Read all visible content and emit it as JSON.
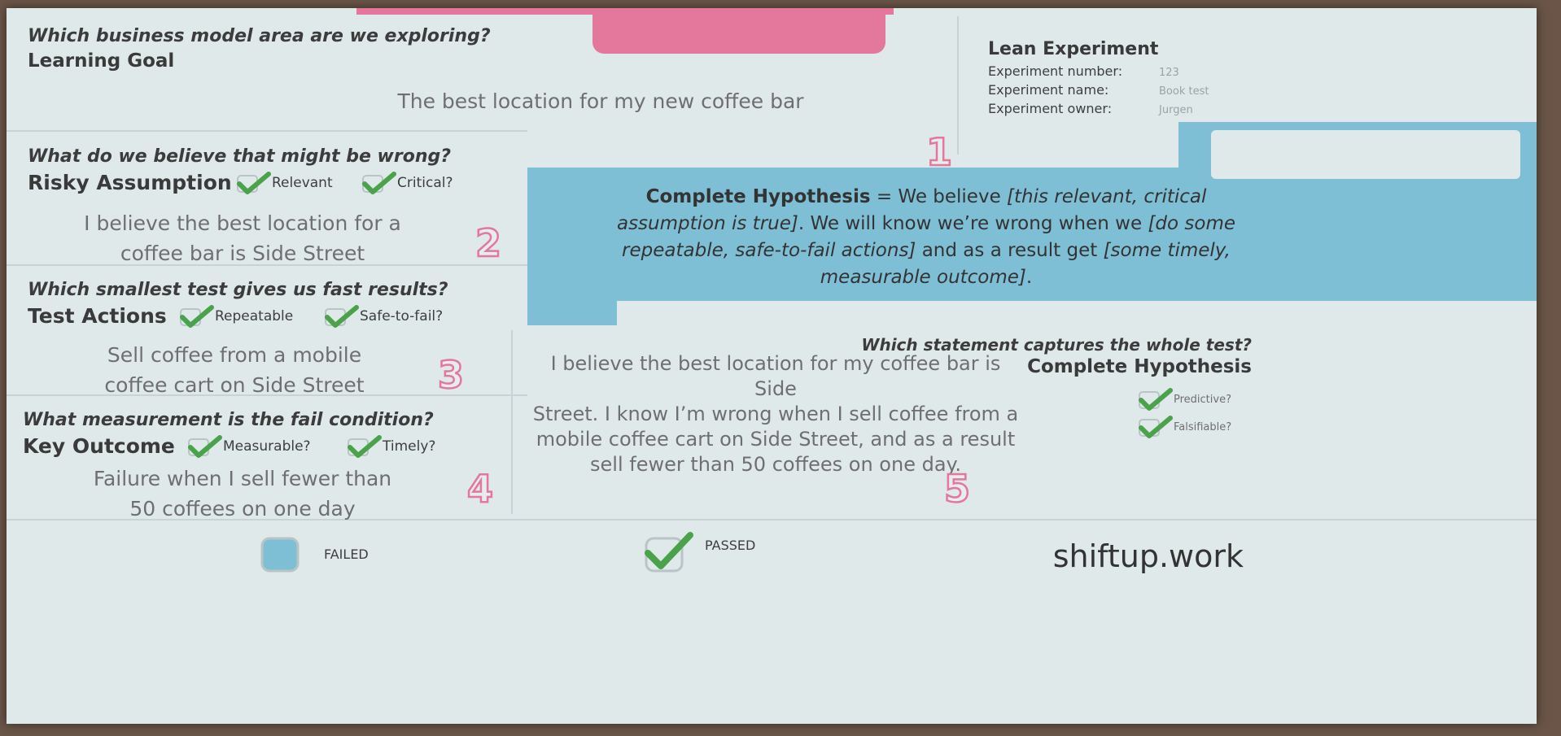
{
  "card_title": "Lean Experiment",
  "experiment": {
    "number_label": "Experiment number:",
    "number_value": "123",
    "name_label": "Experiment name:",
    "name_value": "Book test",
    "owner_label": "Experiment owner:",
    "owner_value": "Jurgen"
  },
  "s1": {
    "question": "Which business model area are we exploring?",
    "heading": "Learning Goal",
    "body": "The best location for my new coffee bar",
    "number": "1"
  },
  "s2": {
    "question": "What do we believe that might be wrong?",
    "heading": "Risky Assumption",
    "check1": "Relevant",
    "check2": "Critical?",
    "body_line1": "I believe the best location for a",
    "body_line2": "coffee bar is Side Street",
    "number": "2"
  },
  "s3": {
    "question": "Which smallest test gives us fast results?",
    "heading": "Test Actions",
    "check1": "Repeatable",
    "check2": "Safe-to-fail?",
    "body_line1": "Sell coffee from a mobile",
    "body_line2": "coffee cart on Side Street",
    "number": "3"
  },
  "s4": {
    "question": "What measurement is the fail condition?",
    "heading": "Key Outcome",
    "check1": "Measurable?",
    "check2": "Timely?",
    "body_line1": "Failure when I sell fewer than",
    "body_line2": "50 coffees on one day",
    "number": "4"
  },
  "s5": {
    "question": "Which statement captures the whole test?",
    "heading": "Complete Hypothesis",
    "check1": "Predictive?",
    "check2": "Falsifiable?",
    "body_line1": "I believe the best location for my coffee bar is Side",
    "body_line2": "Street. I know I’m wrong when I sell coffee from a",
    "body_line3": "mobile coffee cart on Side Street, and as a result",
    "body_line4": "sell fewer than 50 coffees on one day.",
    "number": "5"
  },
  "formula": {
    "bold": "Complete Hypothesis",
    "eq": " = We believe ",
    "p1": "[this relevant, critical assumption is true]",
    "p2": ". We will know we’re wrong when we ",
    "p3": "[do some repeatable, safe-to-fail actions]",
    "p4": " and as a result get ",
    "p5": "[some timely, measurable outcome]",
    "p6": "."
  },
  "result": {
    "failed": "FAILED",
    "passed": "PASSED"
  },
  "brand": "shiftup.work",
  "icons": {
    "check": "checkmark-icon",
    "box": "checkbox-icon"
  },
  "colors": {
    "pink": "#e3779c",
    "blue": "#7fbfd6",
    "check_green": "#4aa24a",
    "panel": "#dfe9ea"
  }
}
